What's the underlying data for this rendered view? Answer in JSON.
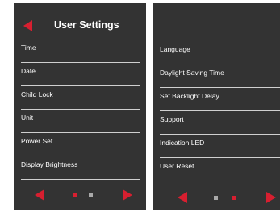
{
  "colors": {
    "background": "#333333",
    "accent": "#d71f30",
    "text": "#ffffff",
    "divider": "#cfcfcf",
    "dot_inactive": "#a9a9a9"
  },
  "screen1": {
    "header": {
      "title": "User Settings",
      "back_icon": "back-arrow-icon"
    },
    "items": [
      {
        "label": "Time"
      },
      {
        "label": "Date"
      },
      {
        "label": "Child Lock"
      },
      {
        "label": "Unit"
      },
      {
        "label": "Power Set"
      },
      {
        "label": "Display Brightness"
      }
    ],
    "pagination": {
      "current_page": 1,
      "total_pages": 2
    }
  },
  "screen2": {
    "items": [
      {
        "label": "Language"
      },
      {
        "label": "Daylight Saving Time"
      },
      {
        "label": "Set Backlight Delay"
      },
      {
        "label": "Support"
      },
      {
        "label": "Indication LED"
      },
      {
        "label": "User Reset"
      }
    ],
    "pagination": {
      "current_page": 2,
      "total_pages": 2
    }
  }
}
